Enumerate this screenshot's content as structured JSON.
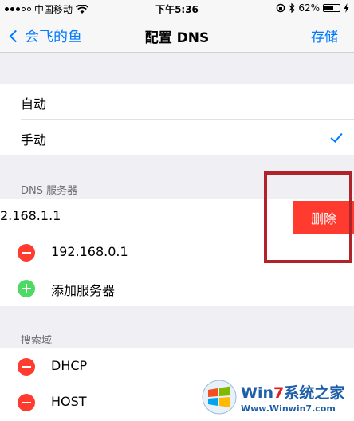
{
  "status_bar": {
    "carrier": "中国移动",
    "time": "下午5:36",
    "battery_percent": "62%",
    "battery_level": 0.62
  },
  "nav": {
    "back_label": "会飞的鱼",
    "title": "配置 DNS",
    "save_label": "存储"
  },
  "mode_options": [
    {
      "label": "自动",
      "selected": false
    },
    {
      "label": "手动",
      "selected": true
    }
  ],
  "dns_section": {
    "header": "DNS 服务器",
    "servers": [
      "2.168.1.1",
      "192.168.0.1"
    ],
    "delete_label": "删除",
    "add_label": "添加服务器"
  },
  "search_section": {
    "header": "搜索域",
    "domains": [
      "DHCP",
      "HOST"
    ]
  },
  "watermark": {
    "line1_a": "Win",
    "line1_b": "7",
    "line1_c": "系统之家",
    "line2": "Www.Winwin7.com"
  },
  "colors": {
    "ios_blue": "#007aff",
    "delete_red": "#ff3b30",
    "add_green": "#4cd964",
    "highlight_border": "#b0232a"
  },
  "icons": [
    "wifi-icon",
    "back-chevron-icon",
    "checkmark-icon",
    "minus-circle-icon",
    "plus-circle-icon",
    "lock-rotation-icon",
    "bluetooth-icon",
    "charging-icon",
    "windows-logo-icon"
  ]
}
